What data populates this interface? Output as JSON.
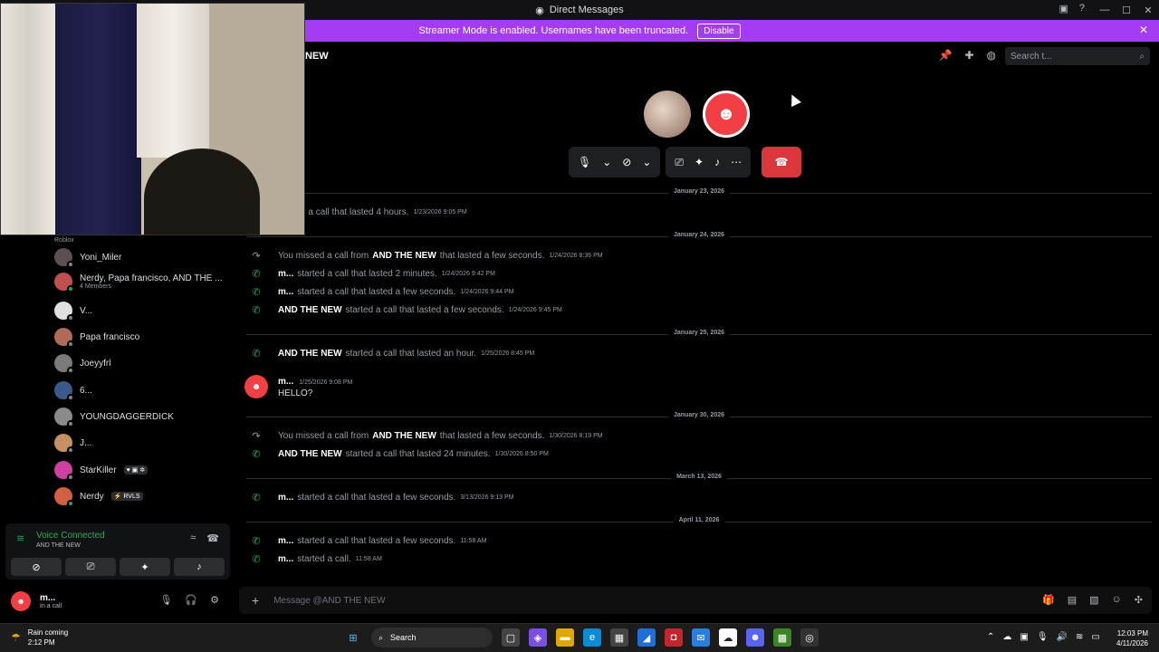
{
  "window": {
    "title": "Direct Messages"
  },
  "banner": {
    "text": "Streamer Mode is enabled. Usernames have been truncated.",
    "button": "Disable"
  },
  "header": {
    "channel_name": "NEW",
    "search_placeholder": "Search t..."
  },
  "dm_list": [
    {
      "name": "Yoni_Miler",
      "sub": "",
      "badge": "",
      "avatar_color": "#5a5050",
      "online": false
    },
    {
      "name": "Nerdy, Papa francisco, AND THE ...",
      "sub": "4 Members",
      "badge": "",
      "avatar_color": "#c0504d",
      "online": true
    },
    {
      "name": "V...",
      "sub": "",
      "badge": "",
      "avatar_color": "#e0e0e0",
      "online": false
    },
    {
      "name": "Papa francisco",
      "sub": "",
      "badge": "",
      "avatar_color": "#b06a5a",
      "online": false
    },
    {
      "name": "Joeyyfrl",
      "sub": "",
      "badge": "",
      "avatar_color": "#7a7a7a",
      "online": false
    },
    {
      "name": "6...",
      "sub": "",
      "badge": "",
      "avatar_color": "#3a5a8a",
      "online": false
    },
    {
      "name": "YOUNGDAGGERDICK",
      "sub": "",
      "badge": "",
      "avatar_color": "#8a8a8a",
      "online": false
    },
    {
      "name": "J...",
      "sub": "",
      "badge": "",
      "avatar_color": "#c89060",
      "online": false
    },
    {
      "name": "StarKiller",
      "sub": "",
      "badge": "♥ ▣ ✲",
      "avatar_color": "#d040a0",
      "online": false
    },
    {
      "name": "Nerdy",
      "sub": "",
      "badge": "⚡ RVLS",
      "avatar_color": "#d06040",
      "online": true
    }
  ],
  "voice": {
    "title": "Voice Connected",
    "channel": "AND THE NEW"
  },
  "user": {
    "name": "m...",
    "status": "In a call"
  },
  "dates": [
    "January 23, 2026",
    "January 24, 2026",
    "January 25, 2026",
    "January 30, 2026",
    "March 13, 2026",
    "April 11, 2026"
  ],
  "messages": [
    {
      "pre": "",
      "bold": "",
      "text": "started a call that lasted 4 hours.",
      "time": "1/23/2026 9:05 PM",
      "missed": false
    },
    {
      "pre": "You missed a call from",
      "bold": "AND THE NEW",
      "text": "that lasted a few seconds.",
      "time": "1/24/2026 8:36 PM",
      "missed": true
    },
    {
      "pre": "",
      "bold": "m...",
      "text": "started a call that lasted 2 minutes.",
      "time": "1/24/2026 9:42 PM",
      "missed": false
    },
    {
      "pre": "",
      "bold": "m...",
      "text": "started a call that lasted a few seconds.",
      "time": "1/24/2026 9:44 PM",
      "missed": false
    },
    {
      "pre": "",
      "bold": "AND THE NEW",
      "text": "started a call that lasted a few seconds.",
      "time": "1/24/2026 9:45 PM",
      "missed": false
    },
    {
      "pre": "",
      "bold": "AND THE NEW",
      "text": "started a call that lasted an hour.",
      "time": "1/25/2026 8:45 PM",
      "missed": false
    },
    {
      "pre": "You missed a call from",
      "bold": "AND THE NEW",
      "text": "that lasted a few seconds.",
      "time": "1/30/2026 8:19 PM",
      "missed": true
    },
    {
      "pre": "",
      "bold": "AND THE NEW",
      "text": "started a call that lasted 24 minutes.",
      "time": "1/30/2026 8:50 PM",
      "missed": false
    },
    {
      "pre": "",
      "bold": "m...",
      "text": "started a call that lasted a few seconds.",
      "time": "3/13/2026 9:13 PM",
      "missed": false
    },
    {
      "pre": "",
      "bold": "m...",
      "text": "started a call that lasted a few seconds.",
      "time": "11:58 AM",
      "missed": false
    },
    {
      "pre": "",
      "bold": "m...",
      "text": "started a call.",
      "time": "11:58 AM",
      "missed": false
    }
  ],
  "chat_message": {
    "author": "m...",
    "time": "1/25/2026 9:08 PM",
    "text": "HELLO?"
  },
  "composer": {
    "placeholder": "Message @AND THE NEW"
  },
  "taskbar": {
    "weather_title": "Rain coming",
    "weather_time": "2:12 PM",
    "search_label": "Search",
    "clock_time": "12:03 PM",
    "clock_date": "4/11/2026"
  },
  "colors": {
    "banner": "#a33cf2",
    "end_call": "#da373c",
    "connected": "#23a55a",
    "avatar_red": "#f23f43"
  }
}
